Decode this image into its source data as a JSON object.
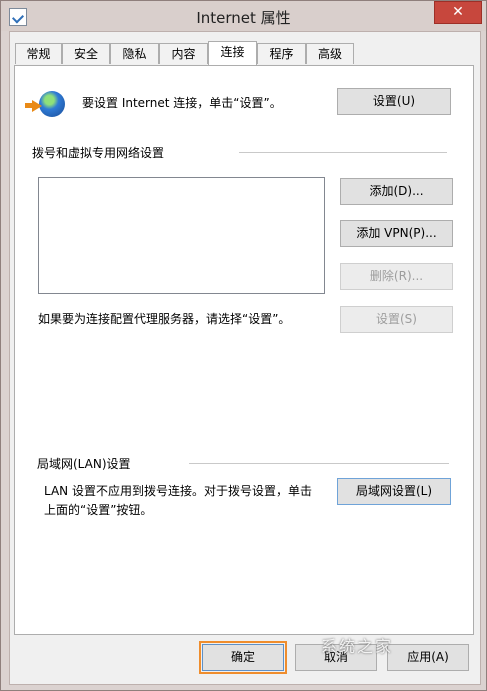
{
  "window": {
    "title": "Internet 属性",
    "close_label": "✕"
  },
  "tabs": [
    {
      "label": "常规"
    },
    {
      "label": "安全"
    },
    {
      "label": "隐私"
    },
    {
      "label": "内容"
    },
    {
      "label": "连接",
      "active": true
    },
    {
      "label": "程序"
    },
    {
      "label": "高级"
    }
  ],
  "connect": {
    "setup_text": "要设置 Internet 连接，单击“设置”。",
    "setup_button": "设置(U)",
    "dialup_group": "拨号和虚拟专用网络设置",
    "add_button": "添加(D)...",
    "add_vpn_button": "添加 VPN(P)...",
    "delete_button": "删除(R)...",
    "proxy_text": "如果要为连接配置代理服务器，请选择“设置”。",
    "settings_button": "设置(S)",
    "lan_group": "局域网(LAN)设置",
    "lan_text_line1": "LAN 设置不应用到拨号连接。对于拨号设置，单击",
    "lan_text_line2": "上面的“设置”按钮。",
    "lan_button": "局域网设置(L)"
  },
  "footer": {
    "ok_button": "确定",
    "cancel_button": "取消",
    "apply_button": "应用(A)"
  },
  "watermark": "系统之家"
}
